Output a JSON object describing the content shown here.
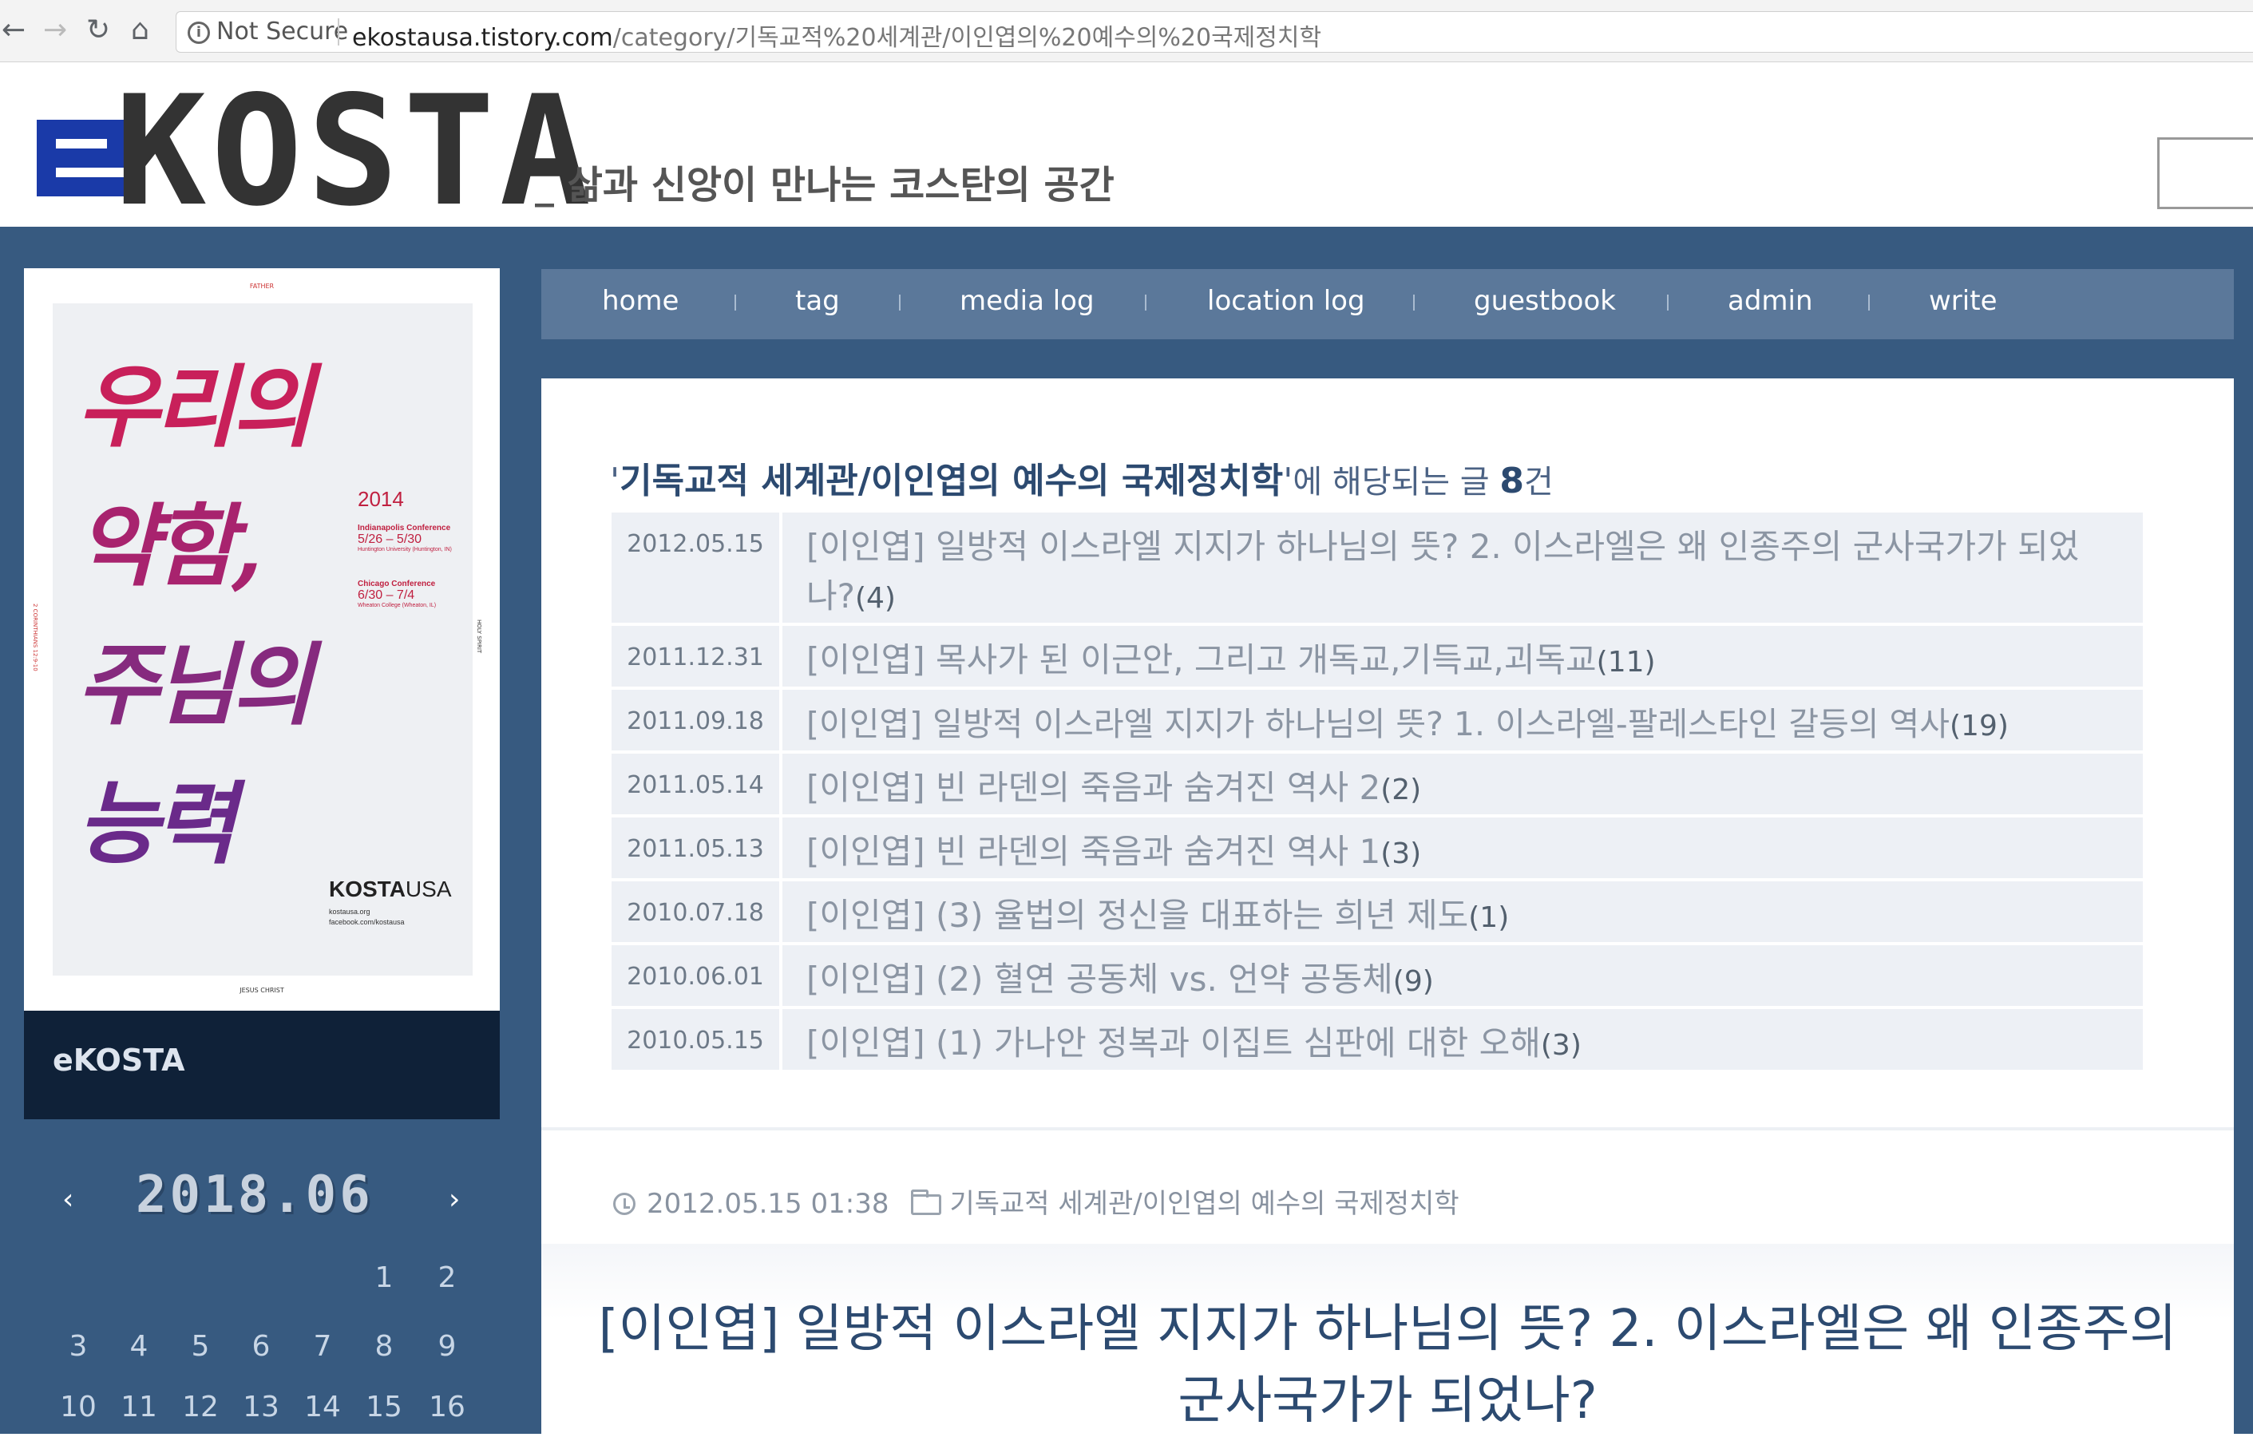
{
  "browser": {
    "back": "←",
    "forward": "→",
    "reload": "↻",
    "home": "⌂",
    "security": "Not Secure",
    "url_host": "ekostausa.tistory.com",
    "url_path": "/category/기독교적%20세계관/이인엽의%20예수의%20국제정치학"
  },
  "header": {
    "logo_text": "KOSTA",
    "tagline": "_ 삶과 신앙이 만나는 코스탄의 공간"
  },
  "poster": {
    "top_label": "FATHER",
    "bottom_label": "JESUS CHRIST",
    "side_left": "2 CORINTHIANS 12:9-10",
    "side_right": "HOLY SPIRIT",
    "headline": [
      "우리의",
      "약함,",
      "주님의",
      "능력"
    ],
    "year": "2014",
    "conf1_title": "Indianapolis Conference",
    "conf1_dates": "5/26 – 5/30",
    "conf1_place": "Huntington University (Huntington, IN)",
    "conf2_title": "Chicago Conference",
    "conf2_dates": "6/30 – 7/4",
    "conf2_place": "Wheaton College (Wheaton, IL)",
    "brand_bold": "KOSTA",
    "brand_rest": "USA",
    "link1": "kostausa.org",
    "link2": "facebook.com/kostausa"
  },
  "sidebar": {
    "blog_name": "eKOSTA"
  },
  "calendar": {
    "month": "2018.06",
    "prev": "‹",
    "next": "›",
    "days": [
      "1",
      "2",
      "3",
      "4",
      "5",
      "6",
      "7",
      "8",
      "9",
      "10",
      "11",
      "12",
      "13",
      "14",
      "15",
      "16"
    ]
  },
  "nav": [
    "home",
    "tag",
    "media log",
    "location log",
    "guestbook",
    "admin",
    "write"
  ],
  "category": {
    "quote_open": "'",
    "name": "기독교적 세계관/이인엽의 예수의 국제정치학",
    "quote_close": "'",
    "mid": "에 해당되는 글 ",
    "count": "8",
    "unit": "건"
  },
  "posts": [
    {
      "date": "2012.05.15",
      "title": "[이인엽] 일방적 이스라엘 지지가 하나님의 뜻? 2. 이스라엘은 왜 인종주의 군사국가가 되었나?",
      "count": "(4)"
    },
    {
      "date": "2011.12.31",
      "title": "[이인엽] 목사가 된 이근안, 그리고 개독교,기득교,괴독교",
      "count": "(11)"
    },
    {
      "date": "2011.09.18",
      "title": "[이인엽] 일방적 이스라엘 지지가 하나님의 뜻? 1. 이스라엘-팔레스타인 갈등의 역사",
      "count": "(19)"
    },
    {
      "date": "2011.05.14",
      "title": "[이인엽] 빈 라덴의 죽음과 숨겨진 역사 2",
      "count": "(2)"
    },
    {
      "date": "2011.05.13",
      "title": "[이인엽] 빈 라덴의 죽음과 숨겨진 역사 1",
      "count": "(3)"
    },
    {
      "date": "2010.07.18",
      "title": "[이인엽] (3) 율법의 정신을 대표하는 희년 제도",
      "count": "(1)"
    },
    {
      "date": "2010.06.01",
      "title": "[이인엽] (2) 혈연 공동체 vs. 언약 공동체",
      "count": "(9)"
    },
    {
      "date": "2010.05.15",
      "title": "[이인엽] (1) 가나안 정복과 이집트 심판에 대한 오해",
      "count": "(3)"
    }
  ],
  "post": {
    "datetime": "2012.05.15 01:38",
    "category": "기독교적 세계관/이인엽의 예수의 국제정치학",
    "title": "[이인엽] 일방적 이스라엘 지지가 하나님의 뜻? 2. 이스라엘은 왜 인종주의 군사국가가 되었나?"
  },
  "colors": {
    "site_blue": "#375a80",
    "nav_bar": "#5b789a",
    "dark_navy": "#0f2138",
    "logo_blue": "#1a3aa8",
    "poster_pink": "#c8205a",
    "poster_purple": "#6a2a8a"
  }
}
